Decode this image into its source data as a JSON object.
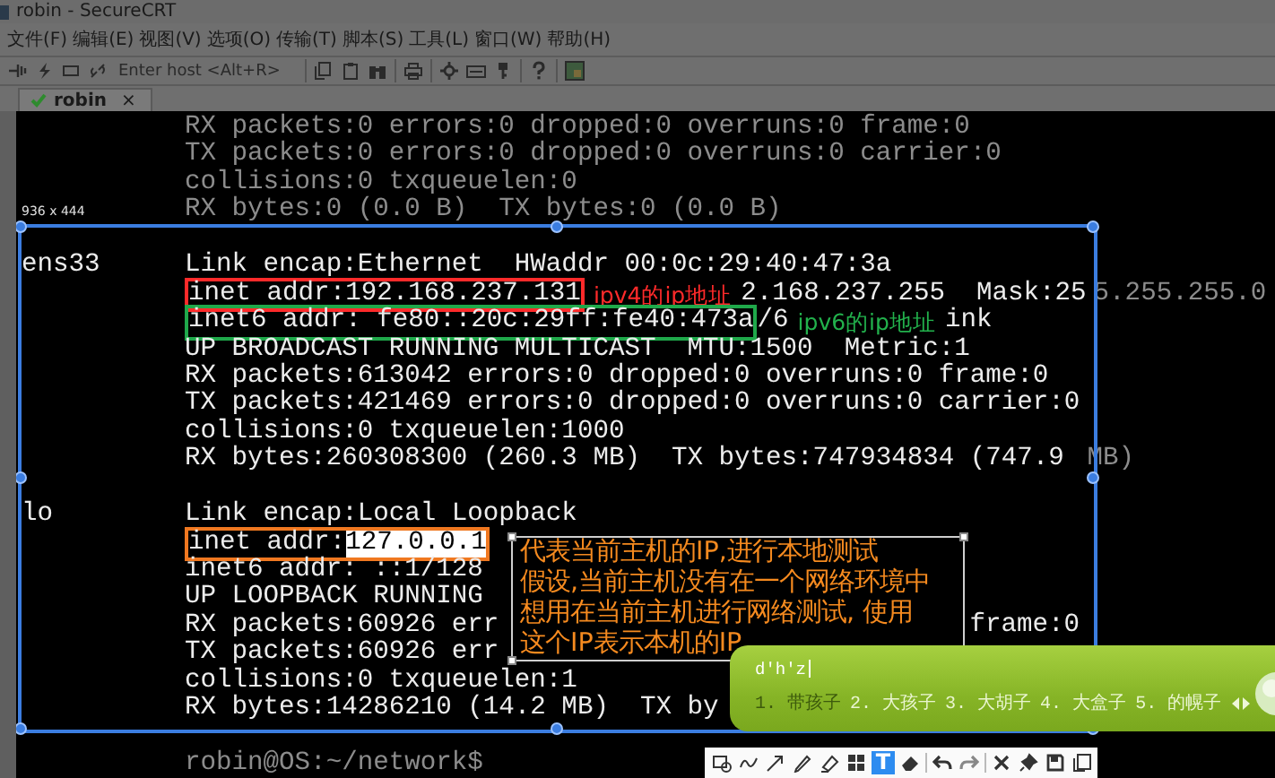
{
  "window": {
    "title": "robin - SecureCRT"
  },
  "menu": [
    "文件(F)",
    "编辑(E)",
    "视图(V)",
    "选项(O)",
    "传输(T)",
    "脚本(S)",
    "工具(L)",
    "窗口(W)",
    "帮助(H)"
  ],
  "toolbar": {
    "host_placeholder": "Enter host <Alt+R>"
  },
  "tabs": [
    {
      "label": "robin",
      "selected": true,
      "connected": true,
      "close": "×"
    }
  ],
  "terminal": {
    "lines": [
      {
        "dimmed": true,
        "parts": [
          {
            "kind": "text",
            "text": "RX packets:0 errors:0 dropped:0 overruns:0 frame:0"
          }
        ]
      },
      {
        "dimmed": true,
        "parts": [
          {
            "kind": "text",
            "text": "TX packets:0 errors:0 dropped:0 overruns:0 carrier:0"
          }
        ]
      },
      {
        "dimmed": true,
        "parts": [
          {
            "kind": "text",
            "text": "collisions:0 txqueuelen:0"
          }
        ]
      },
      {
        "dimmed": true,
        "parts": [
          {
            "kind": "text",
            "text": "RX bytes:0 (0.0 B)  TX bytes:0 (0.0 B)"
          }
        ]
      },
      {
        "blank_before": true,
        "iface": "ens33",
        "parts": [
          {
            "kind": "text",
            "text": "Link encap:Ethernet  HWaddr 00:0c:29:40:47:3a"
          }
        ]
      },
      {
        "parts": [
          {
            "kind": "boxed",
            "color": "#ff2a2a",
            "parts": [
              {
                "kind": "text",
                "text": "inet addr:192.168.237.131"
              }
            ]
          },
          {
            "kind": "note",
            "color": "#ff2a2a",
            "text": "ipv4的ip地址"
          },
          {
            "kind": "text",
            "text": "2.168.237.255  Mask:25"
          },
          {
            "kind": "dim",
            "text": "5.255.255.0"
          }
        ]
      },
      {
        "parts": [
          {
            "kind": "boxed",
            "color": "#1fa84a",
            "parts": [
              {
                "kind": "text",
                "text": "inet6 addr: fe80::20c:29ff:fe40:473a"
              }
            ]
          },
          {
            "kind": "text",
            "text": "/6"
          },
          {
            "kind": "note",
            "color": "#22b14c",
            "text": "ipv6的ip地址"
          },
          {
            "kind": "text",
            "text": "ink"
          }
        ]
      },
      {
        "parts": [
          {
            "kind": "text",
            "text": "UP BROADCAST RUNNING MULTICAST  MTU:1500  Metric:1"
          }
        ]
      },
      {
        "parts": [
          {
            "kind": "text",
            "text": "RX packets:613042 errors:0 dropped:0 overruns:0 frame:0"
          }
        ]
      },
      {
        "parts": [
          {
            "kind": "text",
            "text": "TX packets:421469 errors:0 dropped:0 overruns:0 carrier:0"
          }
        ]
      },
      {
        "parts": [
          {
            "kind": "text",
            "text": "collisions:0 txqueuelen:1000"
          }
        ]
      },
      {
        "parts": [
          {
            "kind": "text",
            "text": "RX bytes:260308300 (260.3 MB)  TX bytes:747934834 (747.9 "
          },
          {
            "kind": "dim",
            "text": "MB)"
          }
        ]
      },
      {
        "blank_before": true,
        "iface": "lo",
        "parts": [
          {
            "kind": "text",
            "text": "Link encap:Local Loopback"
          }
        ]
      },
      {
        "parts": [
          {
            "kind": "boxed",
            "color": "#f07820",
            "parts": [
              {
                "kind": "text",
                "text": "inet addr:"
              },
              {
                "kind": "selected",
                "text": "127.0.0.1"
              }
            ]
          }
        ]
      },
      {
        "parts": [
          {
            "kind": "text",
            "text": "inet6 addr: ::1/128"
          }
        ]
      },
      {
        "parts": [
          {
            "kind": "text",
            "text": "UP LOOPBACK RUNNING"
          }
        ]
      },
      {
        "parts": [
          {
            "kind": "text",
            "text": "RX packets:60926 err"
          },
          {
            "kind": "after-note",
            "text": "frame:0"
          }
        ]
      },
      {
        "parts": [
          {
            "kind": "text",
            "text": "TX packets:60926 err"
          }
        ]
      },
      {
        "parts": [
          {
            "kind": "text",
            "text": "collisions:0 txqueuelen:1"
          }
        ]
      },
      {
        "parts": [
          {
            "kind": "text",
            "text": "RX bytes:14286210 (14.2 MB)  TX by"
          }
        ]
      },
      {
        "blank_before": true,
        "dimmed": true,
        "parts": [
          {
            "kind": "text",
            "text": "robin@OS:~/network$"
          }
        ]
      }
    ]
  },
  "selection": {
    "size_label": "936 x 444"
  },
  "note_box": {
    "color": "#f58a1f",
    "lines": [
      "代表当前主机的IP,进行本地测试",
      "假设,当前主机没有在一个网络环境中",
      "想用在当前主机进行网络测试, 使用",
      "这个IP表示本机的IP"
    ]
  },
  "ime": {
    "input": "d'h'z",
    "candidates": [
      {
        "text": "1. 带孩子",
        "selected": true
      },
      {
        "text": "2. 大孩子",
        "selected": false
      },
      {
        "text": "3. 大胡子",
        "selected": false
      },
      {
        "text": "4. 大盒子",
        "selected": false
      },
      {
        "text": "5. 的幌子",
        "selected": false
      }
    ]
  },
  "capture_toolbar": {
    "tools": [
      {
        "kind": "rectangle",
        "selected": false
      },
      {
        "kind": "curve",
        "selected": false
      },
      {
        "kind": "arrow",
        "selected": false
      },
      {
        "kind": "pen",
        "selected": false
      },
      {
        "kind": "marker",
        "selected": false
      },
      {
        "kind": "mosaic",
        "selected": false
      },
      {
        "kind": "text",
        "label": "T",
        "selected": true
      },
      {
        "kind": "eraser",
        "selected": false
      },
      {
        "kind": "undo",
        "selected": false
      },
      {
        "kind": "redo",
        "selected": false
      },
      {
        "kind": "close",
        "selected": false
      },
      {
        "kind": "pin",
        "selected": false
      },
      {
        "kind": "save",
        "selected": false
      },
      {
        "kind": "copy",
        "selected": false
      }
    ]
  }
}
